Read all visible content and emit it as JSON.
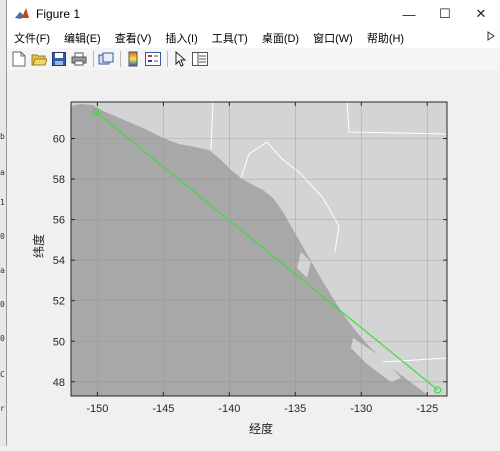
{
  "window": {
    "title": "Figure 1",
    "minimize_glyph": "—",
    "maximize_glyph": "☐",
    "close_glyph": "✕"
  },
  "menu": [
    {
      "label": "文件(F)"
    },
    {
      "label": "编辑(E)"
    },
    {
      "label": "查看(V)"
    },
    {
      "label": "插入(I)"
    },
    {
      "label": "工具(T)"
    },
    {
      "label": "桌面(D)"
    },
    {
      "label": "窗口(W)"
    },
    {
      "label": "帮助(H)"
    }
  ],
  "toolbar": [
    "new-figure-icon",
    "open-icon",
    "save-icon",
    "print-icon",
    "link-plot-icon",
    "colorbar-icon",
    "legend-icon",
    "pointer-icon",
    "property-editor-icon"
  ],
  "left_strip": [
    "b",
    "a",
    "1",
    "0",
    "a",
    "0",
    "0",
    "C",
    "r"
  ],
  "colors": {
    "land": "#d4d4d4",
    "sea": "#a8a8a8",
    "border": "#ffffff",
    "track": "#3ddc3d"
  },
  "chart_data": {
    "type": "map",
    "xlabel": "经度",
    "ylabel": "纬度",
    "xlim": [
      -152,
      -123.5
    ],
    "ylim": [
      47.3,
      61.8
    ],
    "xticks": [
      -150,
      -145,
      -140,
      -135,
      -130,
      -125
    ],
    "yticks": [
      48,
      50,
      52,
      54,
      56,
      58,
      60
    ],
    "xtick_labels": [
      "-150",
      "-145",
      "-140",
      "-135",
      "-130",
      "-125"
    ],
    "ytick_labels": [
      "48",
      "50",
      "52",
      "54",
      "56",
      "58",
      "60"
    ],
    "grid": true,
    "track": {
      "lon": [
        -150.1,
        -124.2
      ],
      "lat": [
        61.3,
        47.6
      ]
    }
  }
}
